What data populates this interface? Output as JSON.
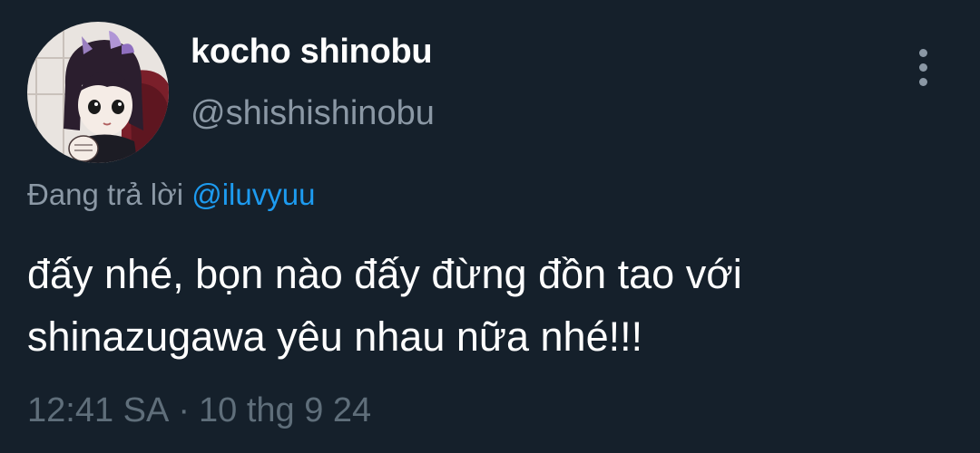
{
  "author": {
    "display_name": "kocho shinobu",
    "handle": "@shishishinobu",
    "avatar_icon": "anime-character-avatar"
  },
  "menu": {
    "icon": "more-vertical-icon"
  },
  "reply": {
    "prefix": "Đang trả lời",
    "mention": "@iluvyuu",
    "mention_color": "#1d9bf0"
  },
  "tweet": {
    "lines": [
      "đấy nhé, bọn nào đấy đừng đồn tao với",
      "shinazugawa yêu nhau nữa nhé!!!"
    ]
  },
  "meta": {
    "time": "12:41 SA",
    "separator": "·",
    "date": "10 thg 9 24"
  },
  "colors": {
    "background": "#15202b",
    "primary_text": "#ffffff",
    "secondary_text": "#8b98a5"
  }
}
